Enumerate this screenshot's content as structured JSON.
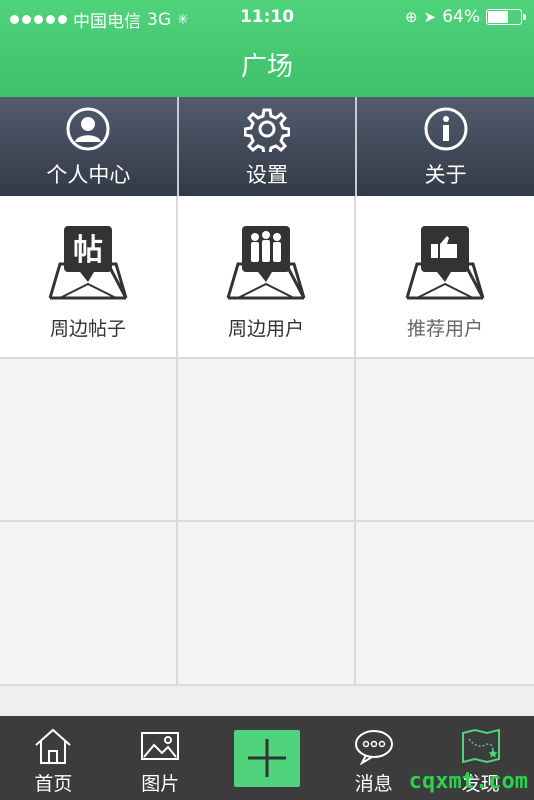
{
  "status_bar": {
    "carrier": "中国电信",
    "network": "3G",
    "time": "11:10",
    "battery_percent": "64%",
    "battery_level": 0.64
  },
  "header": {
    "title": "广场"
  },
  "top_menu": [
    {
      "label": "个人中心",
      "icon": "user-circle-icon"
    },
    {
      "label": "设置",
      "icon": "gear-icon"
    },
    {
      "label": "关于",
      "icon": "info-circle-icon"
    }
  ],
  "grid": [
    {
      "label": "周边帖子",
      "icon": "nearby-posts-icon"
    },
    {
      "label": "周边用户",
      "icon": "nearby-users-icon"
    },
    {
      "label": "推荐用户",
      "icon": "recommend-users-icon"
    }
  ],
  "tabbar": [
    {
      "label": "首页",
      "icon": "home-icon"
    },
    {
      "label": "图片",
      "icon": "image-icon"
    },
    {
      "label": "",
      "icon": "plus-icon"
    },
    {
      "label": "消息",
      "icon": "chat-bubble-icon"
    },
    {
      "label": "发现",
      "icon": "map-icon"
    }
  ],
  "watermark": "cqxmt.com",
  "colors": {
    "accent": "#4fd37b",
    "menu_dark": "#3b4250",
    "tabbar": "#3c3c3c"
  }
}
